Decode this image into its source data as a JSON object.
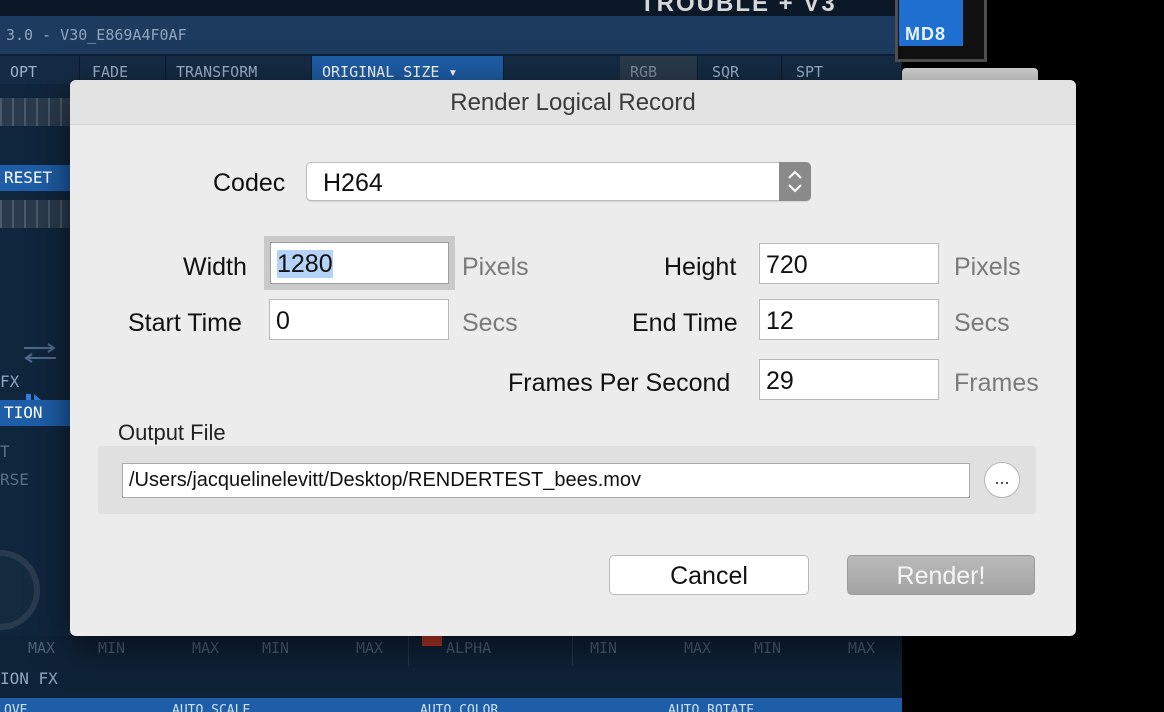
{
  "background_app": {
    "title": "3.0 - V30_E869A4F0AF",
    "brand_partial": "TROUBLE + V3",
    "logo_text": "MD8",
    "tabs": [
      "OPT",
      "FADE",
      "TRANSFORM",
      "ORIGINAL SIZE ▾",
      "RGB",
      "SQR",
      "SPT"
    ],
    "left_labels": {
      "reset": "RESET",
      "fx": "FX",
      "tion": "TION",
      "t": "T",
      "rse": "RSE"
    },
    "bottom_minmax": [
      "MAX",
      "MIN",
      "MAX",
      "MIN",
      "MAX",
      "ALPHA",
      "MIN",
      "MAX",
      "MIN",
      "MAX"
    ],
    "bottom_section_label": "ION FX",
    "auto_labels": [
      "OVE",
      "AUTO SCALE",
      "AUTO COLOR",
      "AUTO ROTATE"
    ]
  },
  "dialog": {
    "title": "Render Logical Record",
    "codec": {
      "label": "Codec",
      "value": "H264"
    },
    "width": {
      "label": "Width",
      "value": "1280",
      "unit": "Pixels"
    },
    "height": {
      "label": "Height",
      "value": "720",
      "unit": "Pixels"
    },
    "start_time": {
      "label": "Start Time",
      "value": "0",
      "unit": "Secs"
    },
    "end_time": {
      "label": "End Time",
      "value": "12",
      "unit": "Secs"
    },
    "fps": {
      "label": "Frames Per Second",
      "value": "29",
      "unit": "Frames"
    },
    "output": {
      "label": "Output File",
      "path": "/Users/jacquelinelevitt/Desktop/RENDERTEST_bees.mov",
      "browse_label": "..."
    },
    "cancel_label": "Cancel",
    "render_label": "Render!"
  }
}
